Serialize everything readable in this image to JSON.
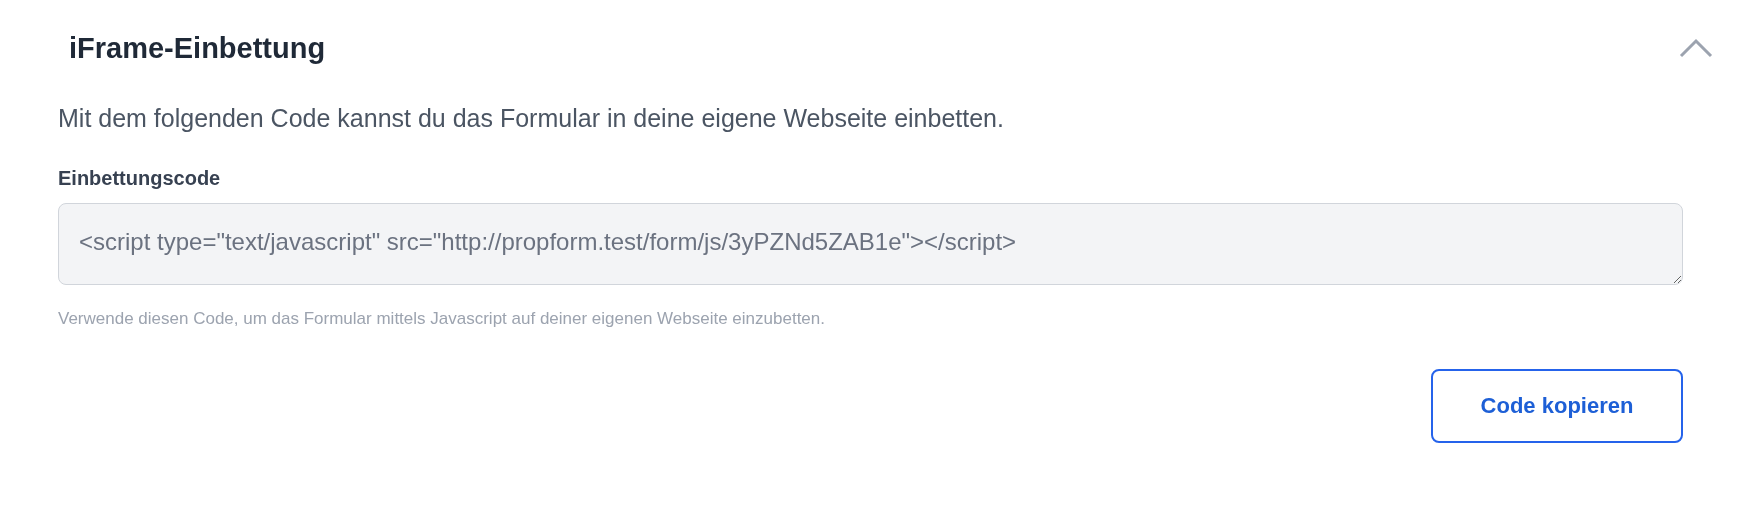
{
  "section": {
    "title": "iFrame-Einbettung",
    "expanded": true,
    "description": "Mit dem folgenden Code kannst du das Formular in deine eigene Webseite einbetten."
  },
  "field": {
    "label": "Einbettungscode",
    "value": "<script type=\"text/javascript\" src=\"http://propform.test/form/js/3yPZNd5ZAB1e\"></script>",
    "help": "Verwende diesen Code, um das Formular mittels Javascript auf deiner eigenen Webseite einzubetten."
  },
  "buttons": [
    "Code kopieren"
  ]
}
